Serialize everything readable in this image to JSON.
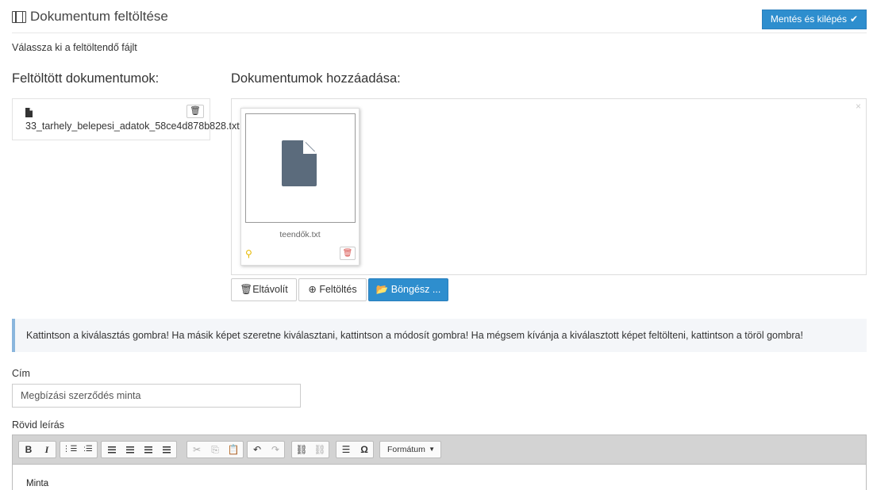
{
  "header": {
    "title": "Dokumentum feltöltése",
    "save_button": "Mentés és kilépés",
    "title_icon": "film-icon",
    "check_icon": "check-icon"
  },
  "subtitle": "Válassza ki a feltöltendő fájlt",
  "uploaded": {
    "heading": "Feltöltött dokumentumok:",
    "files": [
      {
        "name": "33_tarhely_belepesi_adatok_58ce4d878b828.txt",
        "icon": "file-icon",
        "delete_icon": "trash-icon"
      }
    ]
  },
  "add": {
    "heading": "Dokumentumok hozzáadása:",
    "close_glyph": "×",
    "preview_file": {
      "name": "teendők.txt",
      "icon": "file-icon",
      "drag_icon": "drag-handle-icon",
      "delete_icon": "trash-icon"
    },
    "buttons": {
      "remove": "Eltávolít",
      "upload": "Feltöltés",
      "browse": "Böngész ..."
    }
  },
  "info_text": "Kattintson a kiválasztás gombra! Ha másik képet szeretne kiválasztani, kattintson a módosít gombra! Ha mégsem kívánja a kiválasztott képet feltölteni, kattintson a töröl gombra!",
  "form": {
    "title_label": "Cím",
    "title_value": "Megbízási szerződés minta",
    "desc_label": "Rövid leírás"
  },
  "editor": {
    "format_label": "Formátum",
    "content": "Minta",
    "toolbar_icons": [
      "bold-icon",
      "italic-icon",
      "ordered-list-icon",
      "unordered-list-icon",
      "align-left-icon",
      "align-center-icon",
      "align-right-icon",
      "justify-icon",
      "cut-icon",
      "copy-icon",
      "paste-icon",
      "undo-icon",
      "redo-icon",
      "link-icon",
      "unlink-icon",
      "horizontal-rule-icon",
      "special-char-icon"
    ]
  },
  "colors": {
    "primary": "#2e8ece",
    "info_border": "#8ab6dd",
    "info_bg": "#f4f6f9",
    "danger": "#d9534f",
    "warning": "#e6b800"
  }
}
